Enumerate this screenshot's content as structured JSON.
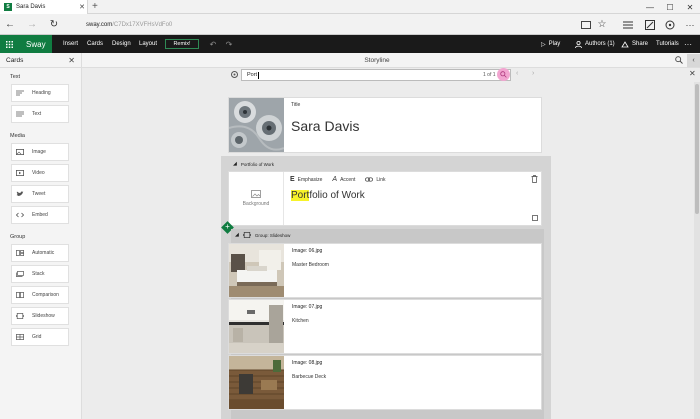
{
  "browser": {
    "tab_title": "Sara Davis",
    "tab_favicon": "S",
    "url_host": "sway.com",
    "url_path": "/C7Dx17XVFHsVdFo0"
  },
  "app": {
    "brand": "Sway",
    "menu": [
      "Insert",
      "Cards",
      "Design",
      "Layout"
    ],
    "remix_label": "Remix!",
    "play_label": "Play",
    "authors_label": "Authors (1)",
    "share_label": "Share",
    "tutorials_label": "Tutorials",
    "accent_color": "#107c41"
  },
  "cards_panel": {
    "title": "Cards",
    "categories": [
      {
        "label": "Text",
        "items": [
          "Heading",
          "Text"
        ]
      },
      {
        "label": "Media",
        "items": [
          "Image",
          "Video",
          "Tweet",
          "Embed"
        ]
      },
      {
        "label": "Group",
        "items": [
          "Automatic",
          "Stack",
          "Comparison",
          "Slideshow",
          "Grid"
        ]
      }
    ]
  },
  "storyline": {
    "title": "Storyline",
    "find": {
      "query": "Port",
      "count": "1 of 1",
      "highlight_color": "#f7f32a"
    },
    "title_card": {
      "label": "Title",
      "text": "Sara Davis"
    },
    "section": {
      "heading": "Portfolio of Work",
      "toolbar": [
        "Emphasize",
        "Accent",
        "Link"
      ],
      "background_label": "Background",
      "text_highlight": "Port",
      "text_rest": "folio of Work"
    },
    "group": {
      "heading": "Group: Slideshow",
      "images": [
        {
          "file": "Image: 06.jpg",
          "caption": "Master Bedroom"
        },
        {
          "file": "Image: 07.jpg",
          "caption": "Kitchen"
        },
        {
          "file": "Image: 08.jpg",
          "caption": "Barbecue Deck"
        }
      ]
    }
  }
}
